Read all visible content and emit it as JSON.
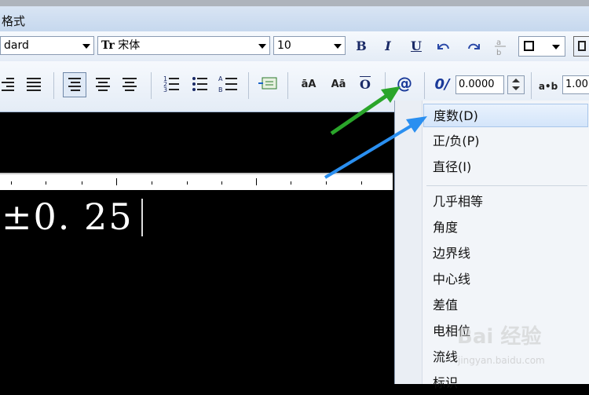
{
  "title": "格式",
  "toolbar1": {
    "style_value": "dard",
    "font_value": "宋体",
    "font_prefix": "Tr",
    "size_value": "10",
    "bold": "B",
    "italic": "I",
    "underline": "U"
  },
  "toolbar2": {
    "case_upper": "āA",
    "case_lower": "Aā",
    "overline": "O",
    "symbol": "@",
    "oblique": "0/",
    "oblique_value": "0.0000",
    "tracking_label": "a•b",
    "tracking_value": "1.00"
  },
  "editor": {
    "text": "±0. 25"
  },
  "menu": {
    "items": [
      "度数(D)",
      "正/负(P)",
      "直径(I)",
      "几乎相等",
      "角度",
      "边界线",
      "中心线",
      "差值",
      "电相位",
      "流线",
      "标识"
    ]
  },
  "watermark": {
    "logo": "Bai 经验",
    "url": "jingyan.baidu.com"
  },
  "colors": {
    "green_arrow": "#2aa52a",
    "blue_arrow": "#2a8ff0",
    "menu_highlight": "#d4e5fa"
  }
}
